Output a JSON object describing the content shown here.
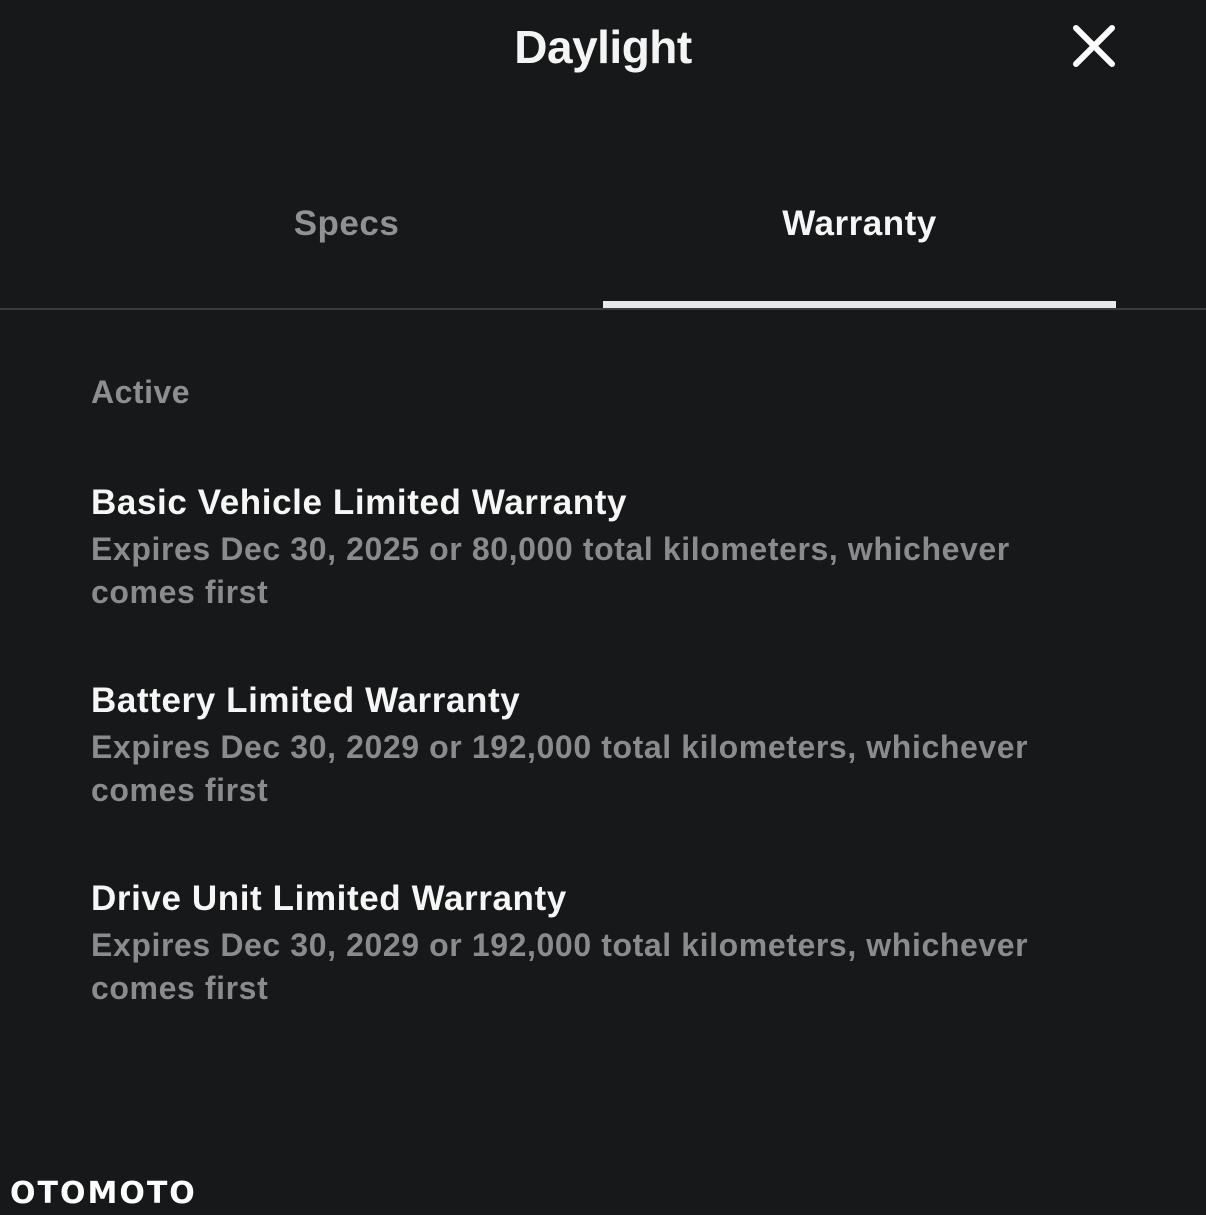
{
  "header": {
    "title": "Daylight",
    "close_icon": "close-icon"
  },
  "tabs": [
    {
      "label": "Specs",
      "active": false
    },
    {
      "label": "Warranty",
      "active": true
    }
  ],
  "section_label": "Active",
  "warranties": [
    {
      "title": "Basic Vehicle Limited Warranty",
      "detail": "Expires Dec 30, 2025 or 80,000 total kilometers, whichever comes first"
    },
    {
      "title": "Battery Limited Warranty",
      "detail": "Expires Dec 30, 2029 or 192,000 total kilometers, whichever comes first"
    },
    {
      "title": "Drive Unit Limited Warranty",
      "detail": "Expires Dec 30, 2029 or 192,000 total kilometers, whichever comes first"
    }
  ],
  "watermark": "OTOMOTO",
  "colors": {
    "background": "#171819",
    "active_text": "#f6f6f6",
    "muted_text": "#8c8e90",
    "active_underline": "#e9e9ea",
    "divider": "#3a3b3d"
  }
}
